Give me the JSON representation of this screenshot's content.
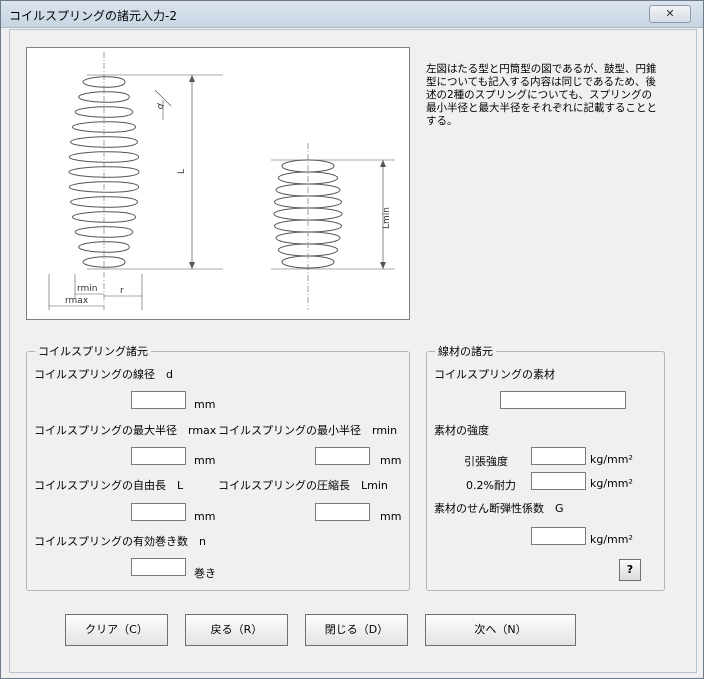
{
  "window": {
    "title": "コイルスプリングの諸元入力-2",
    "close_label": "✕"
  },
  "description": "左図はたる型と円筒型の図であるが、鼓型、円錐型についても記入する内容は同じであるため、後述の2種のスプリングについても、スプリングの最小半径と最大半径をそれぞれに記載することとする。",
  "figure": {
    "labels": {
      "d": "d",
      "L": "L",
      "rmin": "rmin",
      "rmax": "rmax",
      "r": "r",
      "Lmin": "Lmin"
    }
  },
  "spring_group": {
    "title": "コイルスプリング諸元",
    "wire_diameter_label": "コイルスプリングの線径　d",
    "wire_diameter_value": "",
    "wire_diameter_unit": "mm",
    "max_radius_label": "コイルスプリングの最大半径　rmax",
    "max_radius_value": "",
    "max_radius_unit": "mm",
    "min_radius_label": "コイルスプリングの最小半径　rmin",
    "min_radius_value": "",
    "min_radius_unit": "mm",
    "free_length_label": "コイルスプリングの自由長　L",
    "free_length_value": "",
    "free_length_unit": "mm",
    "compressed_length_label": "コイルスプリングの圧縮長　Lmin",
    "compressed_length_value": "",
    "compressed_length_unit": "mm",
    "active_coils_label": "コイルスプリングの有効巻き数　n",
    "active_coils_value": "",
    "active_coils_unit": "巻き"
  },
  "material_group": {
    "title": "線材の諸元",
    "material_label": "コイルスプリングの素材",
    "material_value": "",
    "strength_label": "素材の強度",
    "tensile_label": "引張強度",
    "tensile_value": "",
    "tensile_unit": "kg/mm²",
    "proof_label": "0.2%耐力",
    "proof_value": "",
    "proof_unit": "kg/mm²",
    "shear_label": "素材のせん断弾性係数　G",
    "shear_value": "",
    "shear_unit": "kg/mm²",
    "help_label": "?"
  },
  "buttons": {
    "clear": "クリア（C）",
    "back": "戻る（R）",
    "close": "閉じる（D）",
    "next": "次へ（N）"
  }
}
